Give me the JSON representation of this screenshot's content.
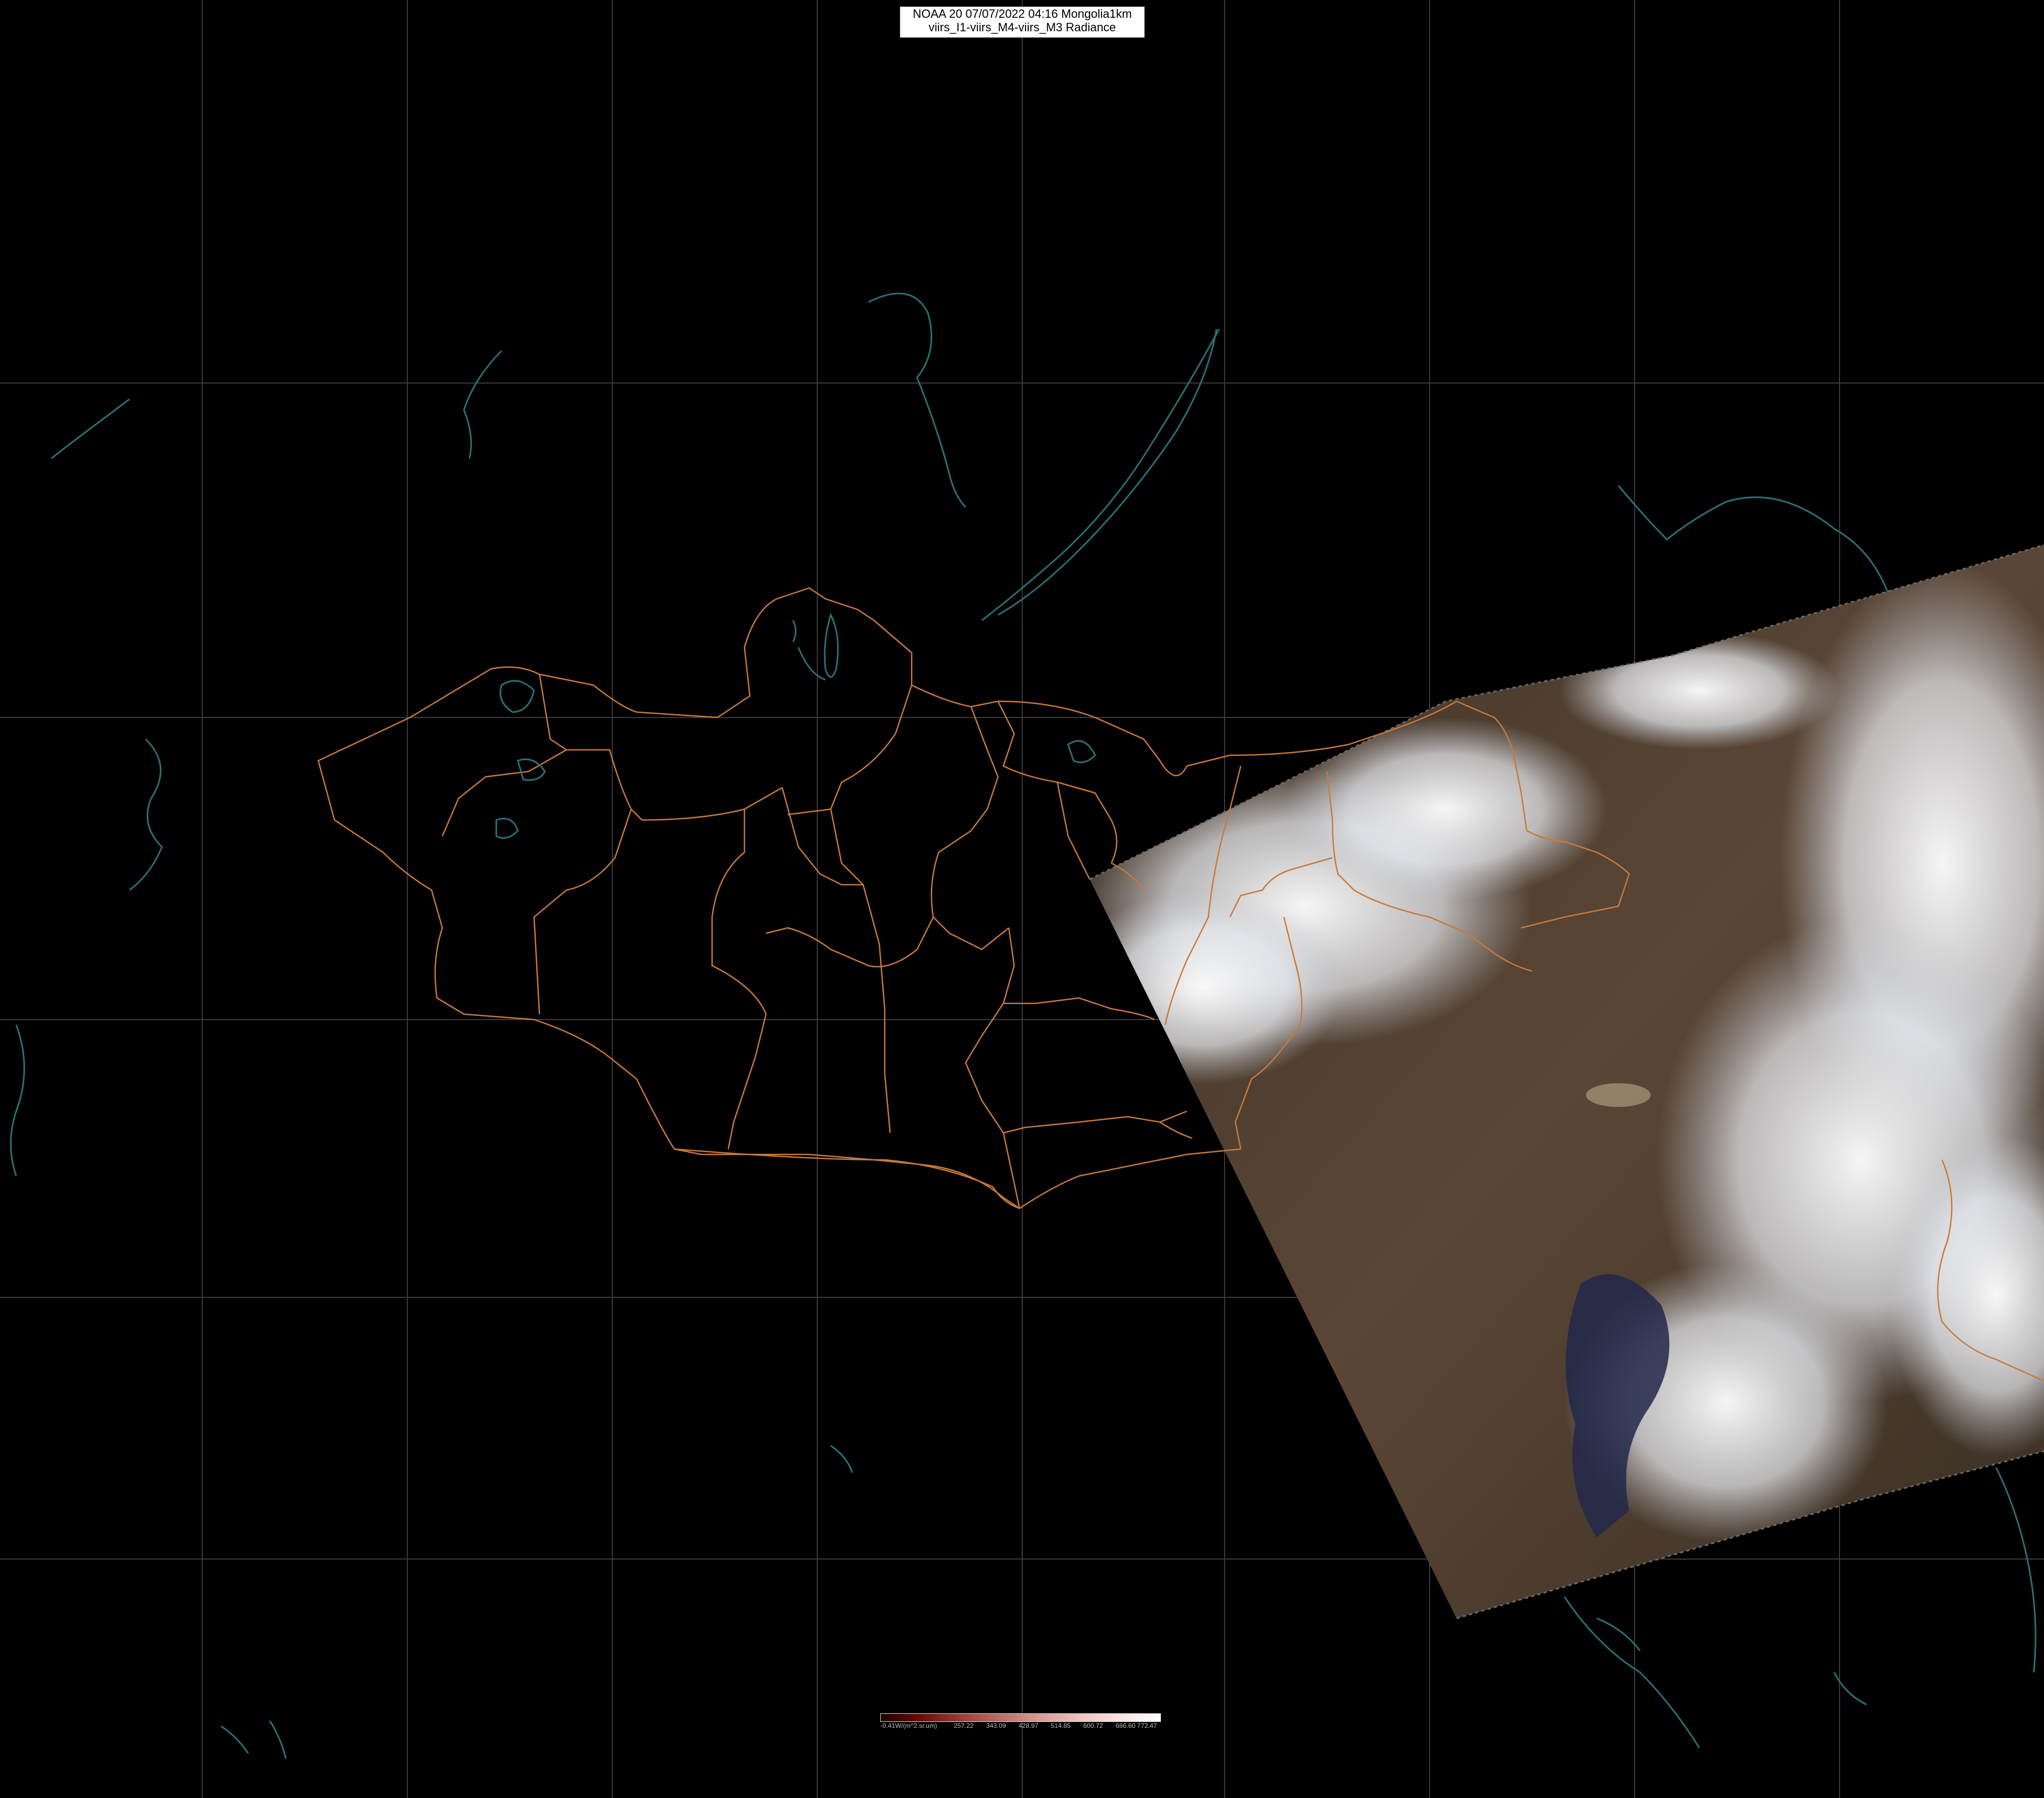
{
  "header": {
    "line1": "NOAA 20 07/07/2022 04:16 Mongolia1km",
    "line2": "viirs_I1-viirs_M4-viirs_M3 Radiance"
  },
  "colors": {
    "background": "#000000",
    "graticule": "#3a3a3a",
    "border": "#c87a3a",
    "water": "#2b6f78",
    "cloud": "#f2f4f7",
    "land": "#4a3d2e"
  },
  "colorbar": {
    "ticks": [
      "-0.41W/(m^2.sr.um)",
      "257.22",
      "343.09",
      "428.97",
      "514.85",
      "600.72",
      "686.60",
      "772.47"
    ]
  },
  "icons": {
    "swath": "satellite-swath-image",
    "borders": "admin-boundary-lines"
  }
}
